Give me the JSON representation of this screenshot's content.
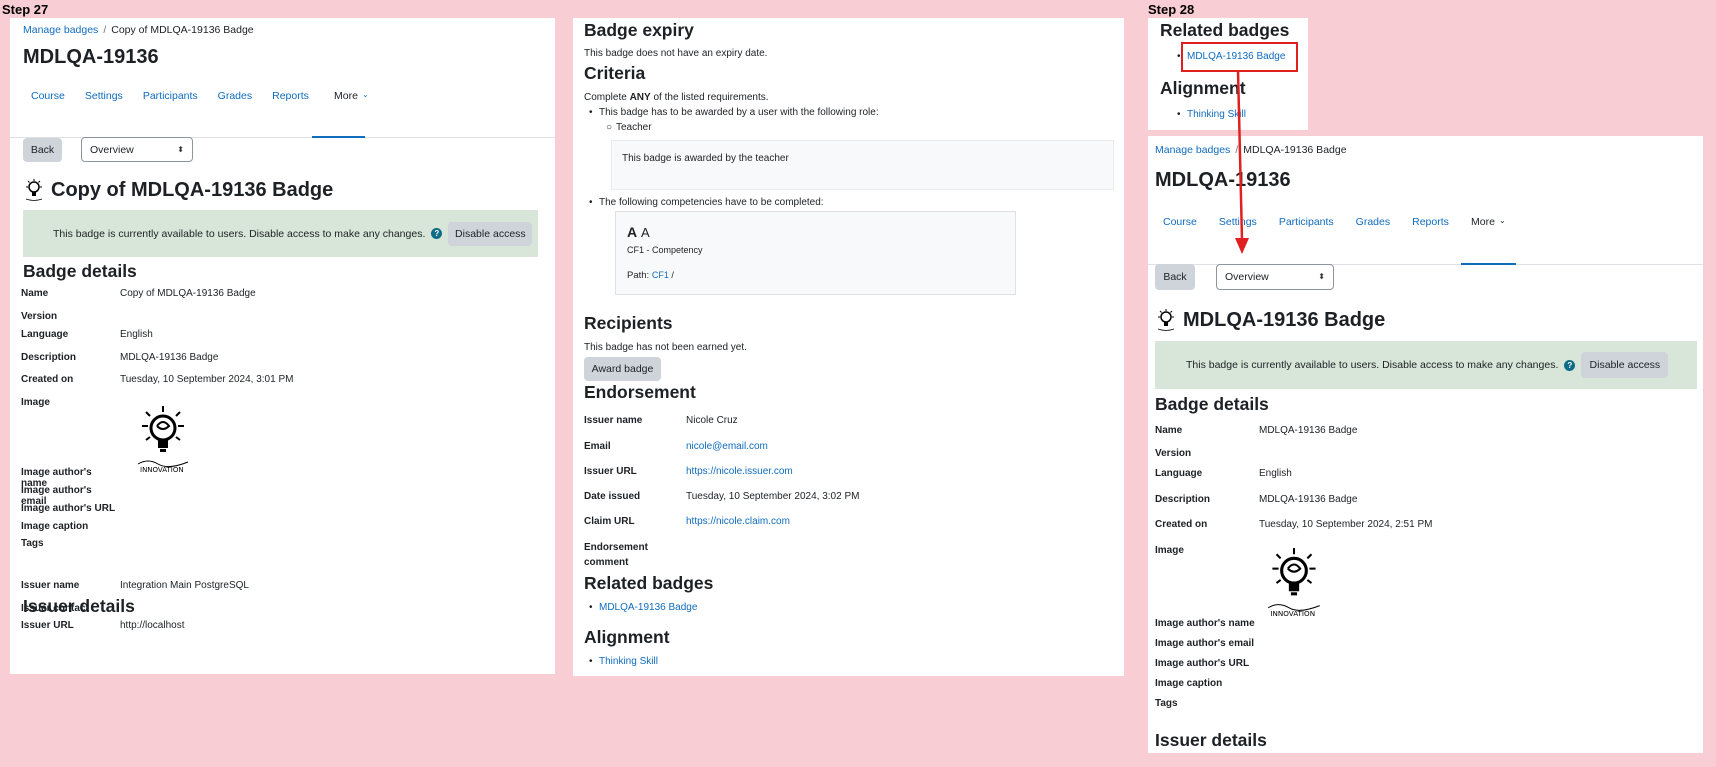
{
  "step27": {
    "label": "Step 27"
  },
  "step28": {
    "label": "Step 28"
  },
  "left": {
    "breadcrumb": {
      "link": "Manage badges",
      "sep": "/",
      "current": "Copy of MDLQA-19136 Badge"
    },
    "course_title": "MDLQA-19136",
    "tabs": [
      "Course",
      "Settings",
      "Participants",
      "Grades",
      "Reports",
      "More"
    ],
    "back": "Back",
    "select": "Overview",
    "badge_title": "Copy of MDLQA-19136 Badge",
    "alert": "This badge is currently available to users. Disable access to make any changes.",
    "disable": "Disable access",
    "badge_details": "Badge details",
    "details": [
      {
        "k": "Name",
        "v": "Copy of MDLQA-19136 Badge"
      },
      {
        "k": "Version",
        "v": ""
      },
      {
        "k": "Language",
        "v": "English"
      },
      {
        "k": "Description",
        "v": "MDLQA-19136 Badge"
      },
      {
        "k": "Created on",
        "v": "Tuesday, 10 September 2024, 3:01 PM"
      },
      {
        "k": "Image",
        "v": ""
      },
      {
        "k": "Image author's name",
        "v": ""
      },
      {
        "k": "Image author's email",
        "v": ""
      },
      {
        "k": "Image author's URL",
        "v": ""
      },
      {
        "k": "Image caption",
        "v": ""
      },
      {
        "k": "Tags",
        "v": ""
      }
    ],
    "issuer_details": "Issuer details",
    "issuer": [
      {
        "k": "Issuer name",
        "v": "Integration Main PostgreSQL"
      },
      {
        "k": "Issuer contact",
        "v": ""
      },
      {
        "k": "Issuer URL",
        "v": "http://localhost"
      }
    ]
  },
  "middle": {
    "expiry_h": "Badge expiry",
    "expiry_t": "This badge does not have an expiry date.",
    "criteria_h": "Criteria",
    "criteria_pre": "Complete ",
    "criteria_any": "ANY",
    "criteria_post": " of the listed requirements.",
    "req1": "This badge has to be awarded by a user with the following role:",
    "role": "Teacher",
    "req1_box": "This badge is awarded by the teacher",
    "req2": "The following competencies have to be completed:",
    "comp_big": "A",
    "comp_small": "A",
    "comp_name": "CF1 - Competency",
    "path_label": "Path: ",
    "path_link": "CF1",
    "path_sep": " /",
    "recipients_h": "Recipients",
    "recipients_t": "This badge has not been earned yet.",
    "award": "Award badge",
    "endorse_h": "Endorsement",
    "endorse": [
      {
        "k": "Issuer name",
        "v": "Nicole Cruz",
        "link": false
      },
      {
        "k": "Email",
        "v": "nicole@email.com",
        "link": true
      },
      {
        "k": "Issuer URL",
        "v": "https://nicole.issuer.com",
        "link": true
      },
      {
        "k": "Date issued",
        "v": "Tuesday, 10 September 2024, 3:02 PM",
        "link": false
      },
      {
        "k": "Claim URL",
        "v": "https://nicole.claim.com",
        "link": true
      }
    ],
    "endorse_comment_1": "Endorsement",
    "endorse_comment_2": "comment",
    "related_h": "Related badges",
    "related_link": "MDLQA-19136 Badge",
    "align_h": "Alignment",
    "align_link": "Thinking Skill"
  },
  "right_top": {
    "related_h": "Related badges",
    "related_link": "MDLQA-19136 Badge",
    "align_h": "Alignment",
    "align_link": "Thinking Skill"
  },
  "right": {
    "breadcrumb": {
      "link": "Manage badges",
      "sep": "/",
      "current": "MDLQA-19136 Badge"
    },
    "course_title": "MDLQA-19136",
    "tabs": [
      "Course",
      "Settings",
      "Participants",
      "Grades",
      "Reports",
      "More"
    ],
    "back": "Back",
    "select": "Overview",
    "badge_title": "MDLQA-19136 Badge",
    "alert": "This badge is currently available to users. Disable access to make any changes.",
    "disable": "Disable access",
    "badge_details": "Badge details",
    "details": [
      {
        "k": "Name",
        "v": "MDLQA-19136 Badge"
      },
      {
        "k": "Version",
        "v": ""
      },
      {
        "k": "Language",
        "v": "English"
      },
      {
        "k": "Description",
        "v": "MDLQA-19136 Badge"
      },
      {
        "k": "Created on",
        "v": "Tuesday, 10 September 2024, 2:51 PM"
      },
      {
        "k": "Image",
        "v": ""
      },
      {
        "k": "Image author's name",
        "v": ""
      },
      {
        "k": "Image author's email",
        "v": ""
      },
      {
        "k": "Image author's URL",
        "v": ""
      },
      {
        "k": "Image caption",
        "v": ""
      },
      {
        "k": "Tags",
        "v": ""
      }
    ],
    "issuer_details": "Issuer details"
  },
  "colors": {
    "link": "#0f6cbf",
    "alert_bg": "#d7e6d8",
    "page_bg": "#f8cdd3",
    "highlight": "#e02020"
  }
}
